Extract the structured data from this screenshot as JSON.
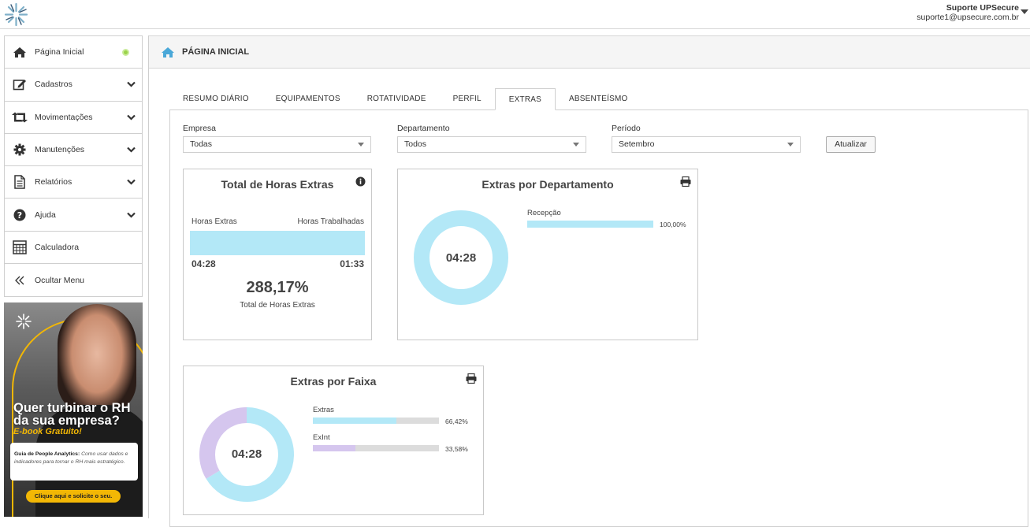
{
  "user": {
    "name": "Suporte UPSecure",
    "email": "suporte1@upsecure.com.br"
  },
  "sidebar": {
    "items": [
      {
        "label": "Página Inicial",
        "icon": "home-icon"
      },
      {
        "label": "Cadastros",
        "icon": "edit-icon"
      },
      {
        "label": "Movimentações",
        "icon": "retweet-icon"
      },
      {
        "label": "Manutenções",
        "icon": "gear-icon"
      },
      {
        "label": "Relatórios",
        "icon": "file-icon"
      },
      {
        "label": "Ajuda",
        "icon": "question-icon"
      },
      {
        "label": "Calculadora",
        "icon": "calculator-icon"
      },
      {
        "label": "Ocultar Menu",
        "icon": "double-chevron-left-icon"
      }
    ]
  },
  "banner": {
    "headline_1": "Quer turbinar o RH",
    "headline_2": "da sua empresa?",
    "subtitle": "E-book Gratuito!",
    "card_bold": "Guia de People Analytics:",
    "card_text": " Como usar dados e indicadores para tornar o RH mais estratégico.",
    "cta": "Clique aqui e solicite o seu."
  },
  "page": {
    "title": "PÁGINA INICIAL"
  },
  "tabs": [
    {
      "label": "RESUMO DIÁRIO",
      "active": false
    },
    {
      "label": "EQUIPAMENTOS",
      "active": false
    },
    {
      "label": "ROTATIVIDADE",
      "active": false
    },
    {
      "label": "PERFIL",
      "active": false
    },
    {
      "label": "EXTRAS",
      "active": true
    },
    {
      "label": "ABSENTEÍSMO",
      "active": false
    }
  ],
  "filters": {
    "empresa": {
      "label": "Empresa",
      "value": "Todas"
    },
    "departamento": {
      "label": "Departamento",
      "value": "Todos"
    },
    "periodo": {
      "label": "Período",
      "value": "Setembro"
    },
    "update_button": "Atualizar"
  },
  "total_panel": {
    "title": "Total de Horas Extras",
    "left_label": "Horas Extras",
    "right_label": "Horas Trabalhadas",
    "left_value": "04:28",
    "right_value": "01:33",
    "percent": "288,17%",
    "percent_label": "Total de Horas Extras",
    "bar_fill": 1.0
  },
  "dept_panel": {
    "title": "Extras por Departamento",
    "center": "04:28",
    "items": [
      {
        "label": "Recepção",
        "percent_text": "100,00%",
        "fraction": 1.0
      }
    ]
  },
  "faixa_panel": {
    "title": "Extras por Faixa",
    "center": "04:28",
    "items": [
      {
        "label": "Extras",
        "percent_text": "66,42%",
        "fraction": 0.6642
      },
      {
        "label": "ExInt",
        "percent_text": "33,58%",
        "fraction": 0.3358
      }
    ]
  },
  "colors": {
    "cyan": "#b3e8f7",
    "purple": "#d5c6ee",
    "grey": "#dcdcdc",
    "accent_home": "#4aa8d8",
    "banner_yellow": "#f2b705"
  }
}
